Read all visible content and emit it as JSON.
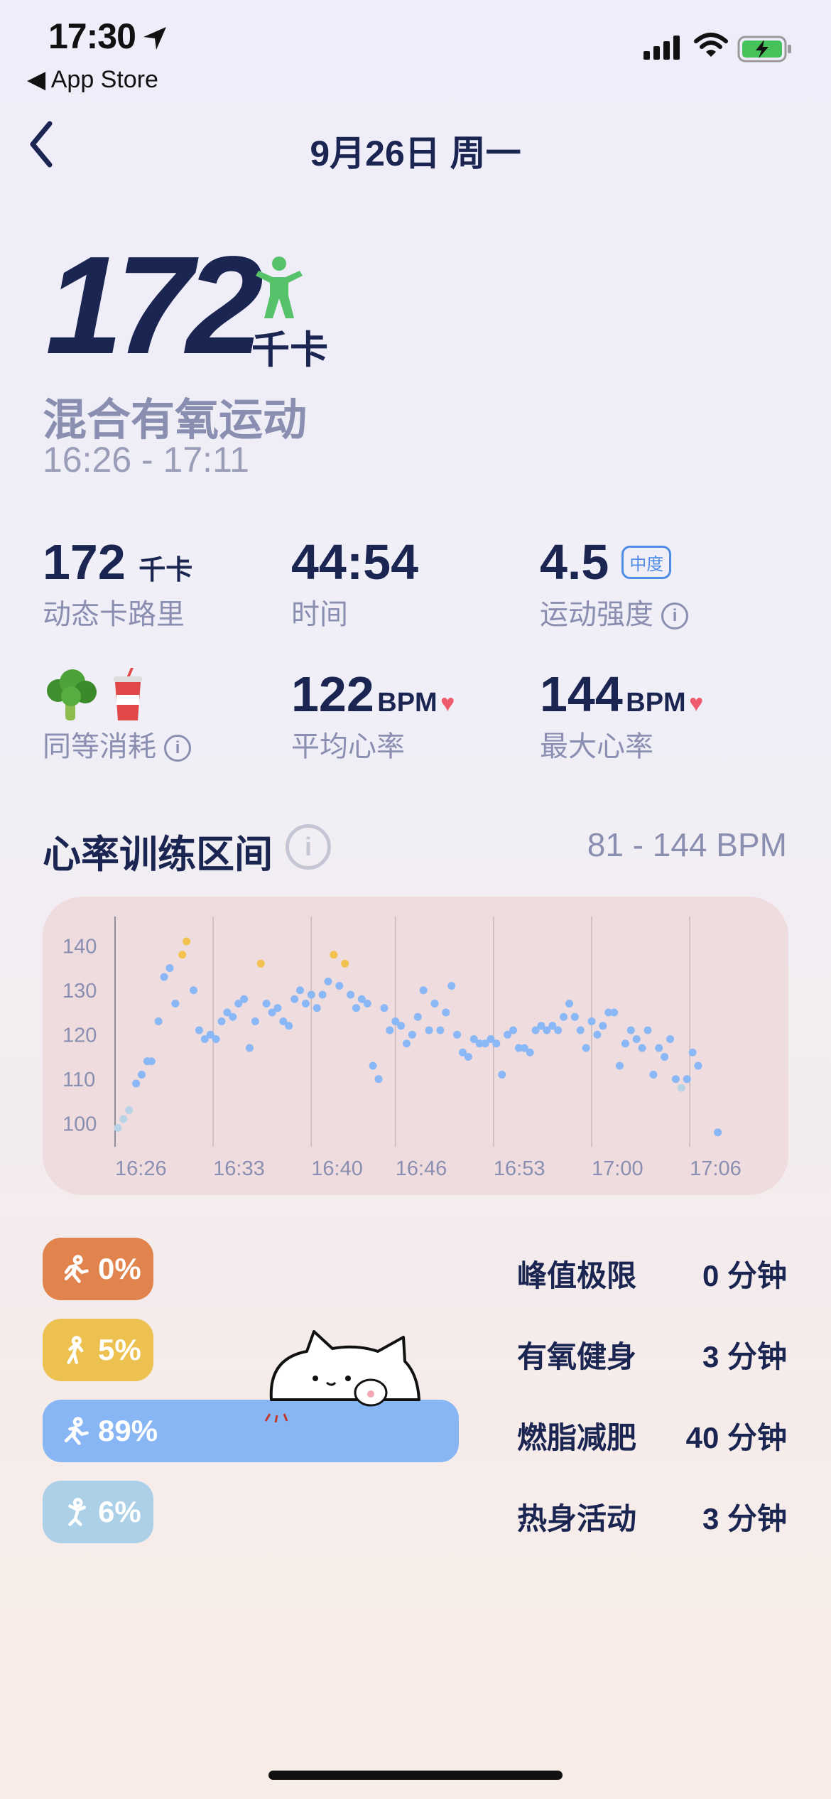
{
  "status_bar": {
    "time": "17:30",
    "back_app": "App Store"
  },
  "nav": {
    "title": "9月26日 周一"
  },
  "hero": {
    "calories": "172",
    "unit": "千卡",
    "activity": "混合有氧运动",
    "time_range": "16:26 - 17:11"
  },
  "stats": {
    "active_cal": {
      "value": "172",
      "unit": "千卡",
      "label": "动态卡路里"
    },
    "duration": {
      "value": "44:54",
      "label": "时间"
    },
    "intensity": {
      "value": "4.5",
      "badge": "中度",
      "label": "运动强度"
    },
    "equivalent": {
      "label": "同等消耗",
      "items": [
        "broccoli",
        "soft-drink"
      ]
    },
    "avg_hr": {
      "value": "122",
      "unit": "BPM",
      "label": "平均心率"
    },
    "max_hr": {
      "value": "144",
      "unit": "BPM",
      "label": "最大心率"
    }
  },
  "hr_section": {
    "title": "心率训练区间",
    "range": "81 - 144 BPM"
  },
  "chart_data": {
    "type": "scatter",
    "yticks": [
      "140",
      "130",
      "120",
      "110",
      "100"
    ],
    "ylim": [
      97,
      145
    ],
    "xticks": [
      "16:26",
      "16:33",
      "16:40",
      "16:46",
      "16:53",
      "17:00",
      "17:06"
    ],
    "xlim_minutes": [
      0,
      45.5
    ],
    "grid": "vertical",
    "colors": {
      "normal": "#8ab7f5",
      "peak": "#f2c14e",
      "warmup": "#b8d3e6"
    },
    "points": [
      [
        0.2,
        99,
        "w"
      ],
      [
        0.6,
        101,
        "w"
      ],
      [
        1.0,
        103,
        "w"
      ],
      [
        1.5,
        109,
        "n"
      ],
      [
        1.9,
        111,
        "n"
      ],
      [
        2.3,
        114,
        "n"
      ],
      [
        2.6,
        114,
        "n"
      ],
      [
        3.1,
        123,
        "n"
      ],
      [
        3.5,
        133,
        "n"
      ],
      [
        3.9,
        135,
        "n"
      ],
      [
        4.3,
        127,
        "n"
      ],
      [
        4.8,
        138,
        "p"
      ],
      [
        5.1,
        141,
        "p"
      ],
      [
        5.6,
        130,
        "n"
      ],
      [
        6.0,
        121,
        "n"
      ],
      [
        6.4,
        119,
        "n"
      ],
      [
        6.8,
        120,
        "n"
      ],
      [
        7.2,
        119,
        "n"
      ],
      [
        7.6,
        123,
        "n"
      ],
      [
        8.0,
        125,
        "n"
      ],
      [
        8.4,
        124,
        "n"
      ],
      [
        8.8,
        127,
        "n"
      ],
      [
        9.2,
        128,
        "n"
      ],
      [
        9.6,
        117,
        "n"
      ],
      [
        10.0,
        123,
        "n"
      ],
      [
        10.4,
        136,
        "p"
      ],
      [
        10.8,
        127,
        "n"
      ],
      [
        11.2,
        125,
        "n"
      ],
      [
        11.6,
        126,
        "n"
      ],
      [
        12.0,
        123,
        "n"
      ],
      [
        12.4,
        122,
        "n"
      ],
      [
        12.8,
        128,
        "n"
      ],
      [
        13.2,
        130,
        "n"
      ],
      [
        13.6,
        127,
        "n"
      ],
      [
        14.0,
        129,
        "n"
      ],
      [
        14.4,
        126,
        "n"
      ],
      [
        14.8,
        129,
        "n"
      ],
      [
        15.2,
        132,
        "n"
      ],
      [
        15.6,
        138,
        "p"
      ],
      [
        16.0,
        131,
        "n"
      ],
      [
        16.4,
        136,
        "p"
      ],
      [
        16.8,
        129,
        "n"
      ],
      [
        17.2,
        126,
        "n"
      ],
      [
        17.6,
        128,
        "n"
      ],
      [
        18.0,
        127,
        "n"
      ],
      [
        18.4,
        113,
        "n"
      ],
      [
        18.8,
        110,
        "n"
      ],
      [
        19.2,
        126,
        "n"
      ],
      [
        19.6,
        121,
        "n"
      ],
      [
        20.0,
        123,
        "n"
      ],
      [
        20.4,
        122,
        "n"
      ],
      [
        20.8,
        118,
        "n"
      ],
      [
        21.2,
        120,
        "n"
      ],
      [
        21.6,
        124,
        "n"
      ],
      [
        22.0,
        130,
        "n"
      ],
      [
        22.4,
        121,
        "n"
      ],
      [
        22.8,
        127,
        "n"
      ],
      [
        23.2,
        121,
        "n"
      ],
      [
        23.6,
        125,
        "n"
      ],
      [
        24.0,
        131,
        "n"
      ],
      [
        24.4,
        120,
        "n"
      ],
      [
        24.8,
        116,
        "n"
      ],
      [
        25.2,
        115,
        "n"
      ],
      [
        25.6,
        119,
        "n"
      ],
      [
        26.0,
        118,
        "n"
      ],
      [
        26.4,
        118,
        "n"
      ],
      [
        26.8,
        119,
        "n"
      ],
      [
        27.2,
        118,
        "n"
      ],
      [
        27.6,
        111,
        "n"
      ],
      [
        28.0,
        120,
        "n"
      ],
      [
        28.4,
        121,
        "n"
      ],
      [
        28.8,
        117,
        "n"
      ],
      [
        29.2,
        117,
        "n"
      ],
      [
        29.6,
        116,
        "n"
      ],
      [
        30.0,
        121,
        "n"
      ],
      [
        30.4,
        122,
        "n"
      ],
      [
        30.8,
        121,
        "n"
      ],
      [
        31.2,
        122,
        "n"
      ],
      [
        31.6,
        121,
        "n"
      ],
      [
        32.0,
        124,
        "n"
      ],
      [
        32.4,
        127,
        "n"
      ],
      [
        32.8,
        124,
        "n"
      ],
      [
        33.2,
        121,
        "n"
      ],
      [
        33.6,
        117,
        "n"
      ],
      [
        34.0,
        123,
        "n"
      ],
      [
        34.4,
        120,
        "n"
      ],
      [
        34.8,
        122,
        "n"
      ],
      [
        35.2,
        125,
        "n"
      ],
      [
        35.6,
        125,
        "n"
      ],
      [
        36.0,
        113,
        "n"
      ],
      [
        36.4,
        118,
        "n"
      ],
      [
        36.8,
        121,
        "n"
      ],
      [
        37.2,
        119,
        "n"
      ],
      [
        37.6,
        117,
        "n"
      ],
      [
        38.0,
        121,
        "n"
      ],
      [
        38.4,
        111,
        "n"
      ],
      [
        38.8,
        117,
        "n"
      ],
      [
        39.2,
        115,
        "n"
      ],
      [
        39.6,
        119,
        "n"
      ],
      [
        40.0,
        110,
        "n"
      ],
      [
        40.4,
        108,
        "w"
      ],
      [
        40.8,
        110,
        "n"
      ],
      [
        41.2,
        116,
        "n"
      ],
      [
        41.6,
        113,
        "n"
      ],
      [
        43.0,
        98,
        "n"
      ]
    ]
  },
  "zones": [
    {
      "pct": "0%",
      "fill": 0.0,
      "name": "峰值极限",
      "minutes": "0 分钟",
      "color": "#e1834c"
    },
    {
      "pct": "5%",
      "fill": 0.05,
      "name": "有氧健身",
      "minutes": "3 分钟",
      "color": "#ecc14f"
    },
    {
      "pct": "89%",
      "fill": 0.89,
      "name": "燃脂减肥",
      "minutes": "40 分钟",
      "color": "#88b6f4"
    },
    {
      "pct": "6%",
      "fill": 0.06,
      "name": "热身活动",
      "minutes": "3 分钟",
      "color": "#acd0e8"
    }
  ]
}
